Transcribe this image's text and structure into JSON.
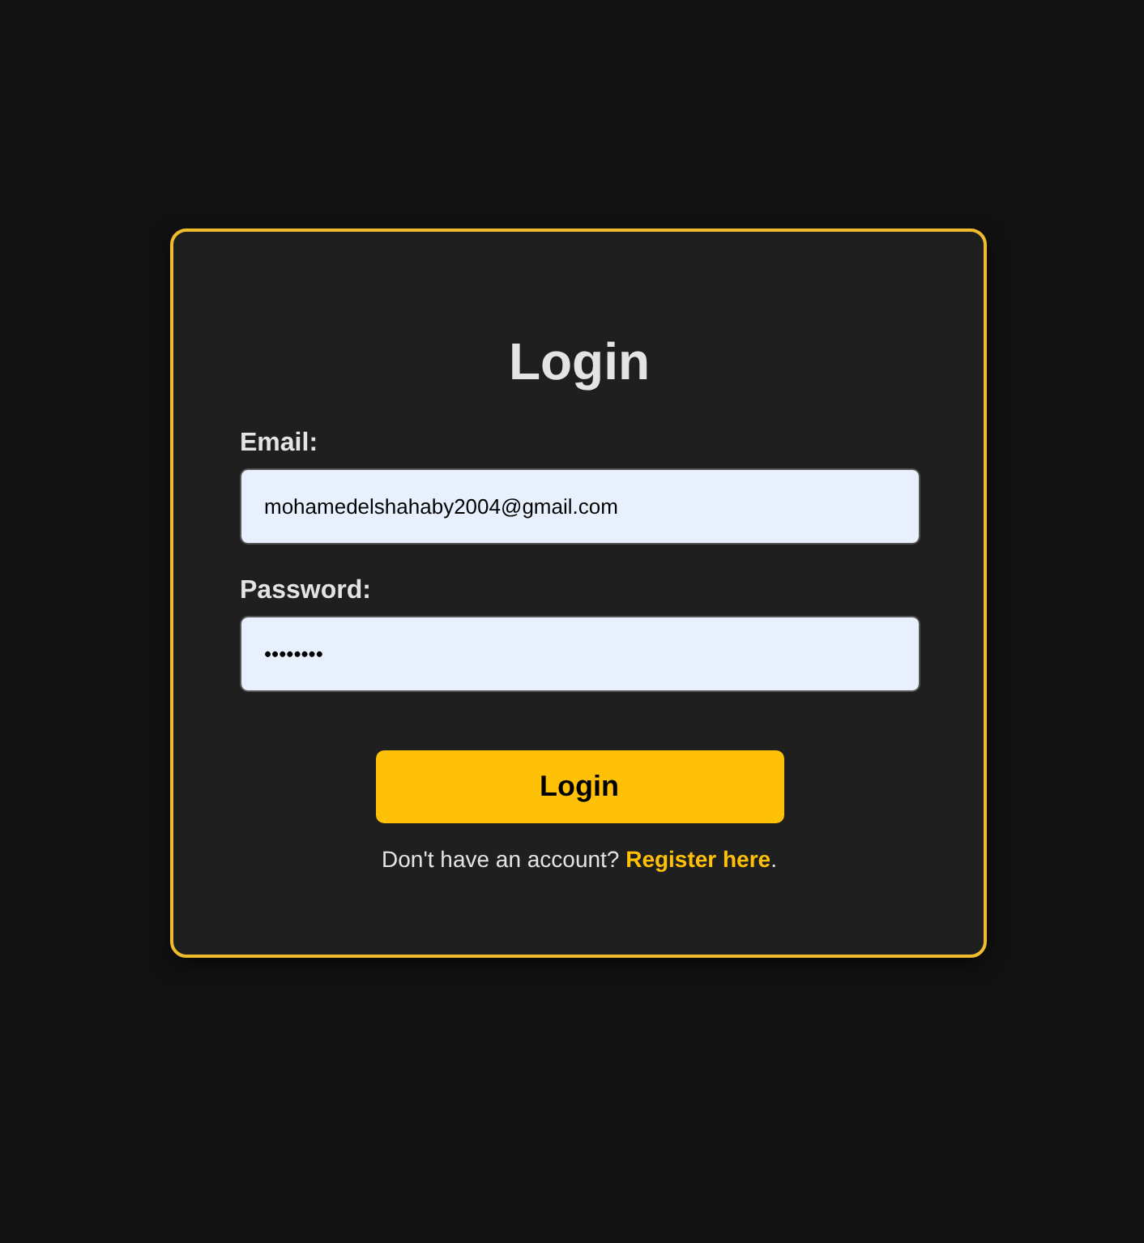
{
  "title": "Login",
  "fields": [
    {
      "label": "Email:",
      "value": "mohamedelshahaby2004@gmail.com"
    },
    {
      "label": "Password:",
      "value": "••••••••"
    }
  ],
  "submit": "Login",
  "register": {
    "prompt": "Don't have an account?",
    "link": "Register here",
    "after": "."
  }
}
